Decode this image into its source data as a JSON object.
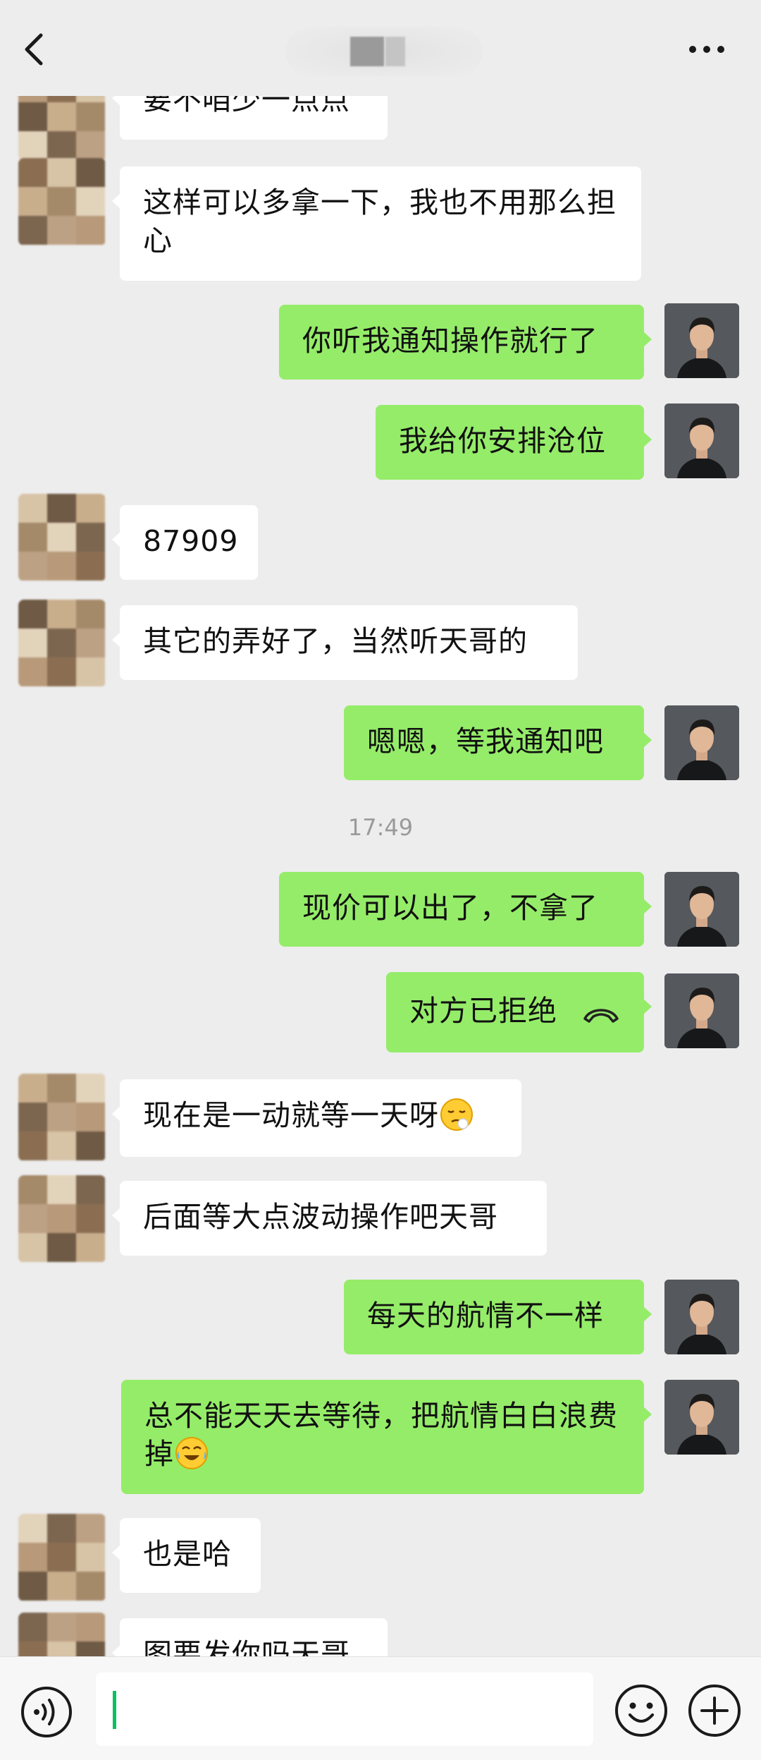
{
  "header": {
    "back_icon": "chevron-left-icon",
    "more_icon": "more-dots-icon"
  },
  "messages": [
    {
      "side": "in",
      "text": "要不咱少一点点"
    },
    {
      "side": "in",
      "text": "这样可以多拿一下，我也不用那么担心"
    },
    {
      "side": "out",
      "text": "你听我通知操作就行了"
    },
    {
      "side": "out",
      "text": "我给你安排沧位"
    },
    {
      "side": "in",
      "text": "87909"
    },
    {
      "side": "in",
      "text": "其它的弄好了，当然听天哥的"
    },
    {
      "side": "out",
      "text": "嗯嗯，等我通知吧"
    },
    {
      "type": "time",
      "text": "17:49"
    },
    {
      "side": "out",
      "text": "现价可以出了，不拿了"
    },
    {
      "side": "out",
      "text": "对方已拒绝",
      "icon": "hangup-phone-icon"
    },
    {
      "side": "in",
      "text": "现在是一动就等一天呀",
      "emoji": "pensive-face-emoji"
    },
    {
      "side": "in",
      "text": "后面等大点波动操作吧天哥"
    },
    {
      "side": "out",
      "text": "每天的航情不一样"
    },
    {
      "side": "out",
      "text": "总不能天天去等待，把航情白白浪费掉",
      "emoji": "crying-laughing-emoji"
    },
    {
      "side": "in",
      "text": "也是哈"
    },
    {
      "side": "in",
      "text": "图要发你吗天哥"
    }
  ],
  "input": {
    "value": ""
  },
  "toolbar": {
    "voice_icon": "voice-icon",
    "emoji_icon": "emoji-icon",
    "plus_icon": "plus-icon"
  }
}
